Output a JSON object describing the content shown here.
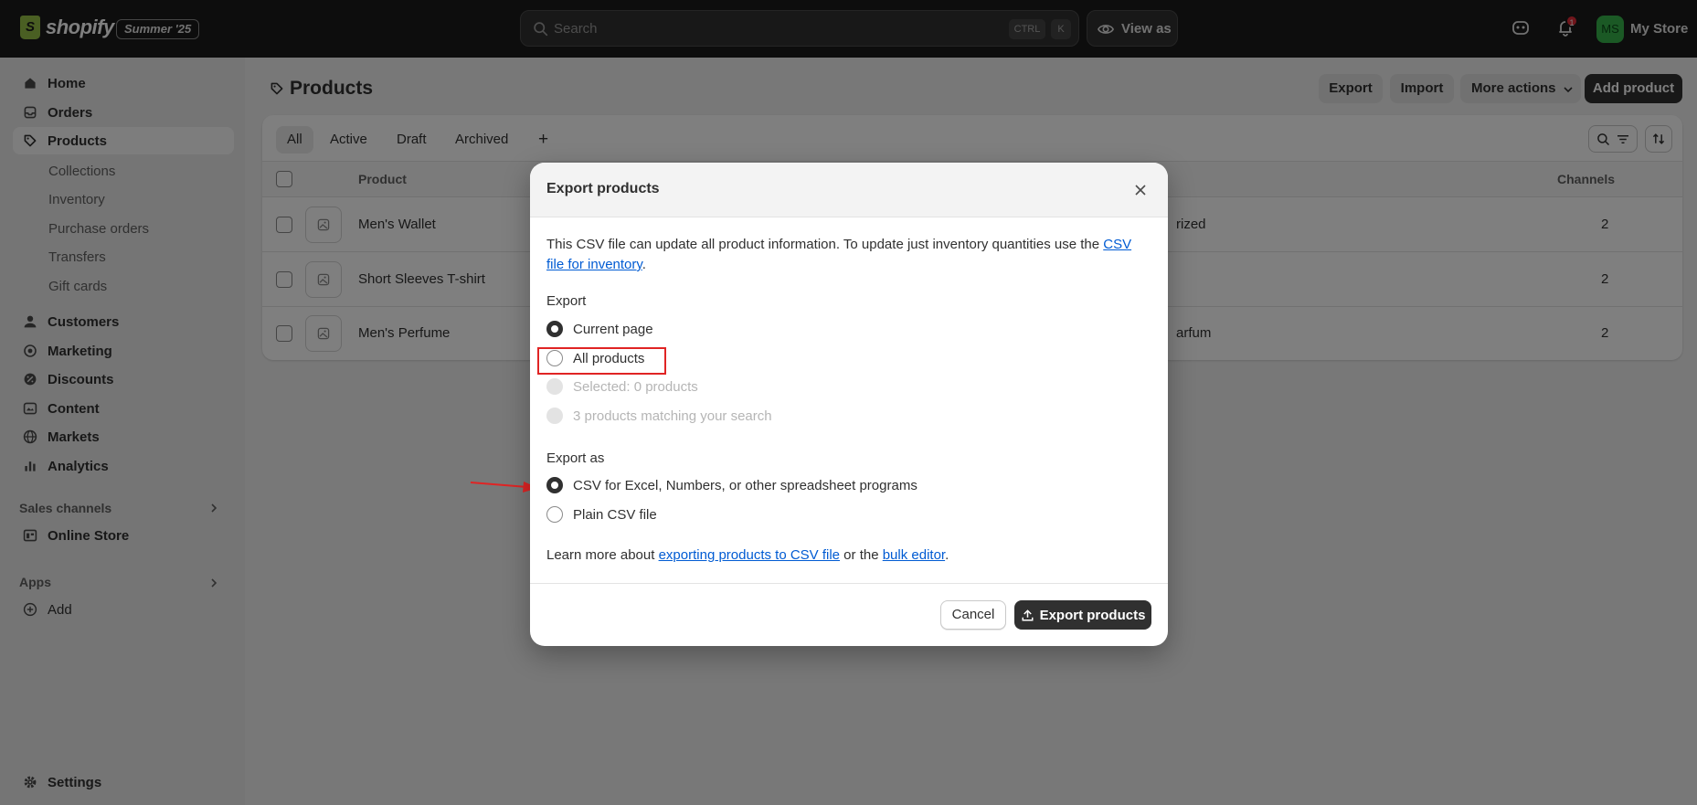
{
  "topbar": {
    "logo_text": "shopify",
    "edition_badge": "Summer '25",
    "search_placeholder": "Search",
    "kbd_ctrl": "CTRL",
    "kbd_k": "K",
    "view_as_label": "View as",
    "notification_count": "1",
    "avatar_initials": "MS",
    "store_name": "My Store"
  },
  "sidebar": {
    "items": [
      {
        "label": "Home",
        "icon": "home-icon"
      },
      {
        "label": "Orders",
        "icon": "orders-icon"
      },
      {
        "label": "Products",
        "icon": "tag-icon",
        "active": true
      },
      {
        "label": "Customers",
        "icon": "person-icon"
      },
      {
        "label": "Marketing",
        "icon": "target-icon"
      },
      {
        "label": "Discounts",
        "icon": "discount-icon"
      },
      {
        "label": "Content",
        "icon": "content-icon"
      },
      {
        "label": "Markets",
        "icon": "globe-icon"
      },
      {
        "label": "Analytics",
        "icon": "bar-chart-icon"
      }
    ],
    "product_subitems": [
      "Collections",
      "Inventory",
      "Purchase orders",
      "Transfers",
      "Gift cards"
    ],
    "sales_channels_label": "Sales channels",
    "online_store_label": "Online Store",
    "apps_label": "Apps",
    "add_label": "Add",
    "settings_label": "Settings"
  },
  "page": {
    "title": "Products",
    "buttons": {
      "export": "Export",
      "import": "Import",
      "more_actions": "More actions",
      "add_product": "Add product"
    },
    "tabs": [
      "All",
      "Active",
      "Draft",
      "Archived",
      "+"
    ],
    "columns": {
      "product": "Product",
      "channels": "Channels"
    },
    "rows": [
      {
        "name": "Men's Wallet",
        "middle": "rized",
        "channels": "2"
      },
      {
        "name": "Short Sleeves T-shirt",
        "middle": "",
        "channels": "2"
      },
      {
        "name": "Men's Perfume",
        "middle": "arfum",
        "channels": "2"
      }
    ]
  },
  "modal": {
    "title": "Export products",
    "description": "This CSV file can update all product information. To update just inventory quantities use the ",
    "inventory_link": "CSV file for inventory",
    "description_end": ".",
    "export_label": "Export",
    "export_options": [
      {
        "label": "Current page",
        "state": "selected"
      },
      {
        "label": "All products",
        "state": "unselected"
      },
      {
        "label": "Selected: 0 products",
        "state": "disabled"
      },
      {
        "label": "3 products matching your search",
        "state": "disabled"
      }
    ],
    "export_as_label": "Export as",
    "format_options": [
      {
        "label": "CSV for Excel, Numbers, or other spreadsheet programs",
        "state": "selected"
      },
      {
        "label": "Plain CSV file",
        "state": "unselected"
      }
    ],
    "learn_prefix": "Learn more about ",
    "learn_link1": "exporting products to CSV file",
    "learn_mid": " or the ",
    "learn_link2": "bulk editor",
    "learn_end": ".",
    "cancel_label": "Cancel",
    "export_button_label": "Export products"
  },
  "colors": {
    "annotation_red": "#e02424",
    "brand_green": "#95bf47",
    "link_blue": "#005bd3"
  }
}
